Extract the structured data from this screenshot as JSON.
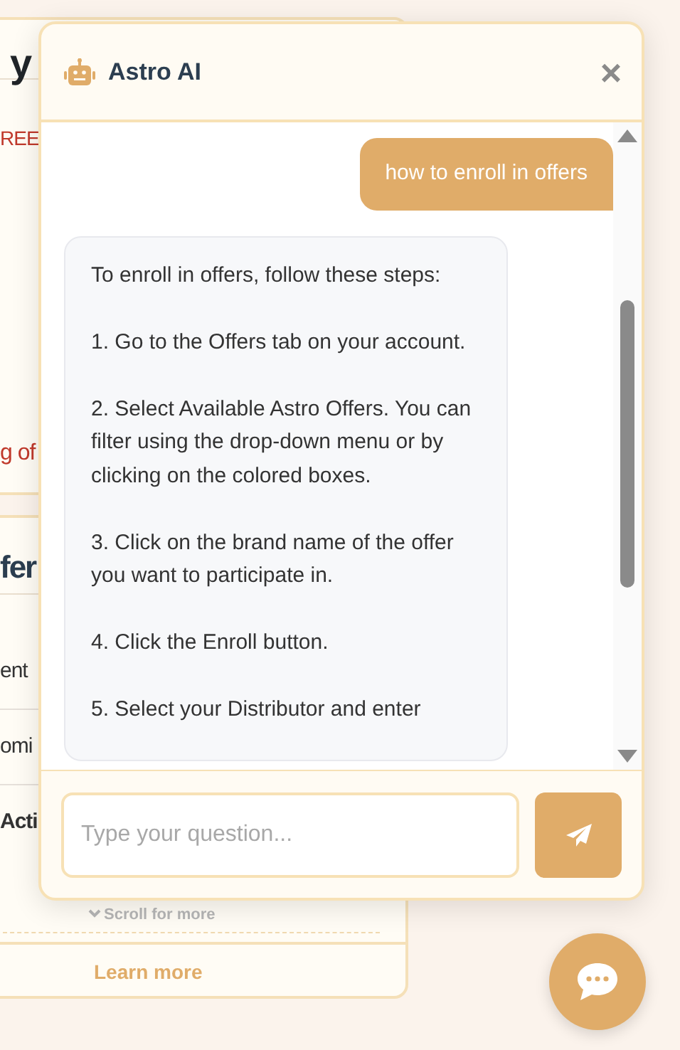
{
  "background_page": {
    "card_1": {
      "heading": "y",
      "line_1": "REE",
      "line_2": "g of"
    },
    "card_2": {
      "heading": "fer",
      "rows": [
        {
          "text": "ent",
          "bold": false
        },
        {
          "text": "omi",
          "bold": false
        },
        {
          "text": "Acti",
          "bold": true
        }
      ],
      "scroll_hint": "Scroll for more",
      "link": "Learn more"
    }
  },
  "chat": {
    "title": "Astro AI",
    "close": "×",
    "messages": [
      {
        "kind": "user",
        "paragraphs": [
          "how to enroll in offers"
        ]
      },
      {
        "kind": "assistant",
        "paragraphs": [
          "To enroll in offers, follow these steps:",
          "1. Go to the Offers tab on your account.",
          "2. Select Available Astro Offers. You can filter using the drop-down menu or by clicking on the colored boxes.",
          "3. Click on the brand name of the offer you want to participate in.",
          "4. Click the Enroll button.",
          "5. Select your Distributor and enter"
        ]
      }
    ],
    "input": {
      "placeholder": "Type your question..."
    }
  }
}
